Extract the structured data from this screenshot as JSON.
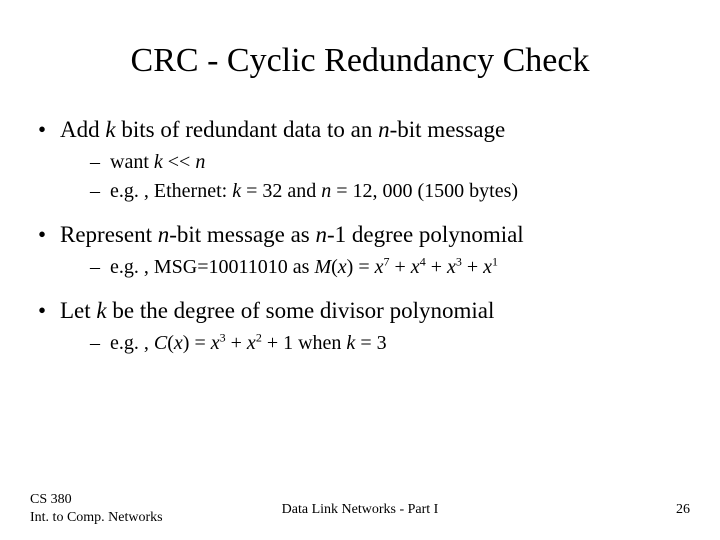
{
  "title": "CRC - Cyclic Redundancy Check",
  "bullets": {
    "b1": {
      "pre": "Add ",
      "k": "k",
      "mid": " bits of redundant data to an ",
      "n": "n",
      "post": "-bit message"
    },
    "b1_sub1": {
      "pre": "want ",
      "k": "k",
      "mid": " << ",
      "n": "n"
    },
    "b1_sub2": {
      "pre": "e.g. , Ethernet:  ",
      "k": "k",
      "eq1": " = 32 and ",
      "n": "n",
      "eq2": " = 12, 000 (1500 bytes)"
    },
    "b2": {
      "pre": "Represent ",
      "n1": "n",
      "mid": "-bit message as ",
      "n2": "n",
      "post": "-1 degree polynomial"
    },
    "b2_sub1": {
      "pre": "e.g. , MSG=10011010 as ",
      "M": "M",
      "x": "x",
      "open": "(",
      "close": ")",
      "eq": " = ",
      "p7": "7",
      "p4": "4",
      "p3": "3",
      "p1": "1",
      "plus": " + "
    },
    "b3": {
      "pre": "Let ",
      "k": "k",
      "post": " be the degree of some divisor polynomial"
    },
    "b3_sub1": {
      "pre": "e.g. , ",
      "C": "C",
      "x": "x",
      "open": "(",
      "close": ")",
      "eq": " = ",
      "p3": "3",
      "p2": "2",
      "plus": " + ",
      "one": "1",
      "when": " when ",
      "k": "k",
      "keq": " = 3"
    }
  },
  "footer": {
    "left1": "CS 380",
    "left2": "Int. to Comp. Networks",
    "center": "Data Link Networks - Part I",
    "right": "26"
  }
}
